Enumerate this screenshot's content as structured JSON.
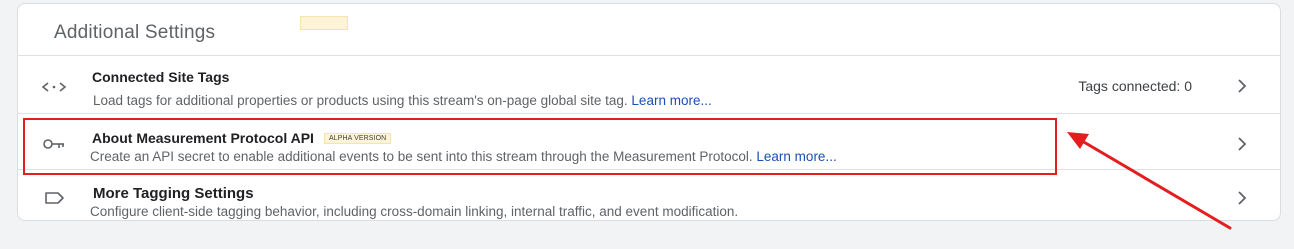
{
  "section": {
    "title": "Additional Settings"
  },
  "rows": [
    {
      "icon": "code-brackets-icon",
      "title": "Connected Site Tags",
      "description": "Load tags for additional properties or products using this stream's on-page global site tag.",
      "link": "Learn more...",
      "status": "Tags connected: 0"
    },
    {
      "icon": "key-icon",
      "title": "About Measurement Protocol API",
      "badge": "ALPHA VERSION",
      "description": "Create an API secret to enable additional events to be sent into this stream through the Measurement Protocol.",
      "link": "Learn more..."
    },
    {
      "icon": "label-tag-icon",
      "title": "More Tagging Settings",
      "description": "Configure client-side tagging behavior, including cross-domain linking, internal traffic, and event modification."
    }
  ],
  "colors": {
    "page_background": "#f1f3f4",
    "link": "#1a4fb5",
    "annotation_red": "#e41e1e",
    "badge_background": "#fdf3d6"
  }
}
